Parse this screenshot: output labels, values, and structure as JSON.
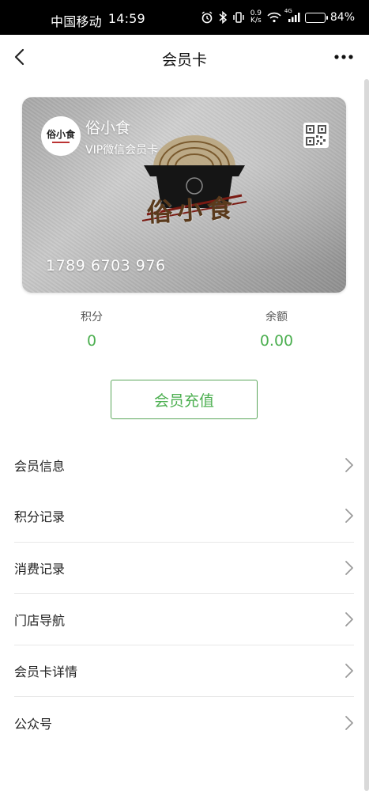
{
  "status_bar": {
    "carrier": "中国移动",
    "time": "14:59",
    "net_speed_value": "0.9",
    "net_speed_unit": "K/s",
    "network_type": "4G",
    "battery_percent": "84%",
    "battery_level": 0.84
  },
  "nav": {
    "title": "会员卡"
  },
  "card": {
    "name": "俗小食",
    "type": "VIP微信会员卡",
    "number": "1789 6703 976",
    "logo_text": "俗小食",
    "brand_text": "俗小食"
  },
  "stats": {
    "points_label": "积分",
    "points_value": "0",
    "balance_label": "余额",
    "balance_value": "0.00"
  },
  "recharge_label": "会员充值",
  "menu": [
    {
      "label": "会员信息"
    },
    {
      "label": "积分记录"
    },
    {
      "label": "消费记录"
    },
    {
      "label": "门店导航"
    },
    {
      "label": "会员卡详情"
    },
    {
      "label": "公众号"
    }
  ],
  "colors": {
    "accent": "#4caf50",
    "status_bar_bg": "#000000"
  }
}
